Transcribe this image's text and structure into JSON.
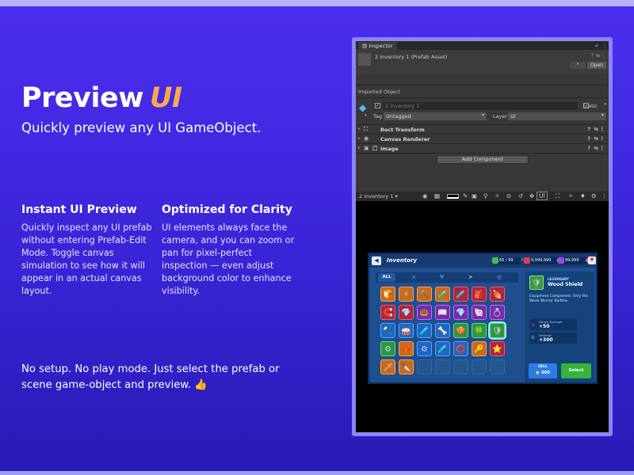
{
  "hero": {
    "title": "Preview",
    "title_accent": "UI",
    "subtitle": "Quickly preview any UI GameObject."
  },
  "features": [
    {
      "title": "Instant UI Preview",
      "text": "Quickly inspect any UI prefab without entering Prefab-Edit Mode. Toggle canvas simulation to see how it will appear in an actual canvas layout."
    },
    {
      "title": "Optimized for Clarity",
      "text": "UI elements always face the camera, and you can zoom or pan for pixel-perfect inspection — even adjust background color to enhance visibility."
    }
  ],
  "footer": {
    "text": "No setup. No play mode. Just select the prefab or scene game-object and preview.",
    "emoji": "👍"
  },
  "colors": {
    "accent": "#ffa94a",
    "background_top": "#4b2ef0",
    "background_bottom": "#2a19b4",
    "editor_bg": "#383838",
    "cube_blue": "#59b7ef"
  },
  "inspector": {
    "tab_label": "Inspector",
    "asset_title": "2 Inventory 1 (Prefab Asset)",
    "open_label": "Open",
    "imported_label": "Imported Object",
    "object_name": "2 Inventory 1",
    "static_label": "Static",
    "tag_label": "Tag",
    "tag_value": "Untagged",
    "layer_label": "Layer",
    "layer_value": "UI",
    "components": [
      {
        "name": "Rect Transform",
        "icon": "rect-transform-icon"
      },
      {
        "name": "Canvas Renderer",
        "icon": "eye-icon"
      },
      {
        "name": "Image",
        "icon": "image-icon"
      }
    ],
    "add_component_label": "Add Component",
    "preview_label": "2 Inventory 1",
    "preview_ui_label": "UI"
  },
  "game": {
    "title": "Inventory",
    "currency_1": "66 / 99",
    "currency_2": "9,999,999",
    "currency_3": "99,999",
    "tab_all": "ALL",
    "item": {
      "rarity": "LEGENDARY",
      "name": "Wood Shield",
      "description": "Equipment Component. Only the Weak Warrior Baitthe.",
      "stat1_label": "Attack Damage",
      "stat1_value": "+50",
      "stat2_label": "Defense",
      "stat2_value": "+300"
    },
    "sell_label": "SELL",
    "sell_price": "300",
    "select_label": "Select"
  }
}
